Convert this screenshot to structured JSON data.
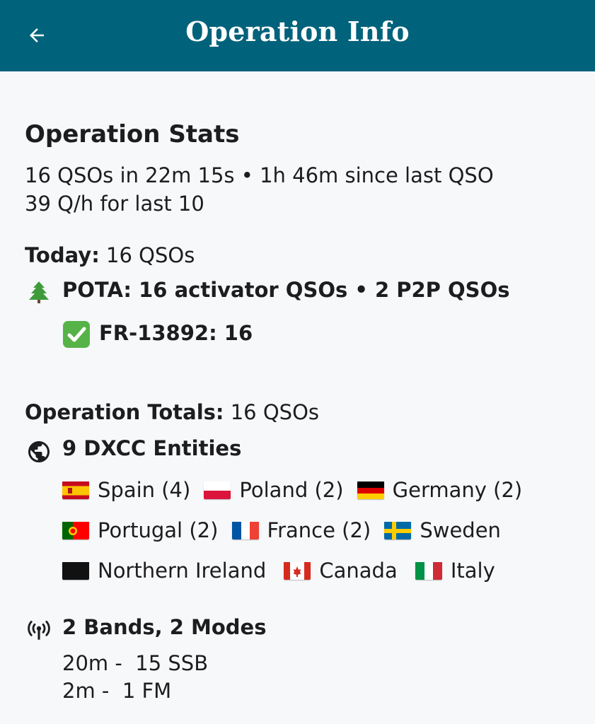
{
  "header": {
    "title": "Operation Info",
    "back_icon": "arrow-left-icon",
    "background": "#00627b"
  },
  "stats": {
    "heading": "Operation Stats",
    "summary_line1": "16 QSOs in 22m 15s • 1h 46m since last QSO",
    "summary_line2": "39 Q/h for last 10"
  },
  "today": {
    "label": "Today:",
    "value": " 16 QSOs",
    "pota_icon": "tree-icon",
    "pota_text": "POTA: 16 activator QSOs • 2 P2P QSOs",
    "park_icon": "check-box-icon",
    "park_text": "FR-13892: 16"
  },
  "totals": {
    "label": "Operation Totals:",
    "value": " 16 QSOs",
    "dxcc_icon": "globe-icon",
    "dxcc_title": "9 DXCC Entities",
    "countries": [
      {
        "flag": "flag-spain-icon",
        "label": "Spain (4)"
      },
      {
        "flag": "flag-poland-icon",
        "label": "Poland (2)"
      },
      {
        "flag": "flag-germany-icon",
        "label": "Germany (2)"
      },
      {
        "flag": "flag-portugal-icon",
        "label": "Portugal (2)"
      },
      {
        "flag": "flag-france-icon",
        "label": "France (2)"
      },
      {
        "flag": "flag-sweden-icon",
        "label": "Sweden"
      },
      {
        "flag": "flag-black-icon",
        "label": "Northern Ireland"
      },
      {
        "flag": "flag-canada-icon",
        "label": "Canada"
      },
      {
        "flag": "flag-italy-icon",
        "label": "Italy"
      }
    ],
    "bands_icon": "antenna-icon",
    "bands_title": "2 Bands, 2 Modes",
    "bands": [
      "20m -  15 SSB",
      "2m -  1 FM"
    ]
  }
}
